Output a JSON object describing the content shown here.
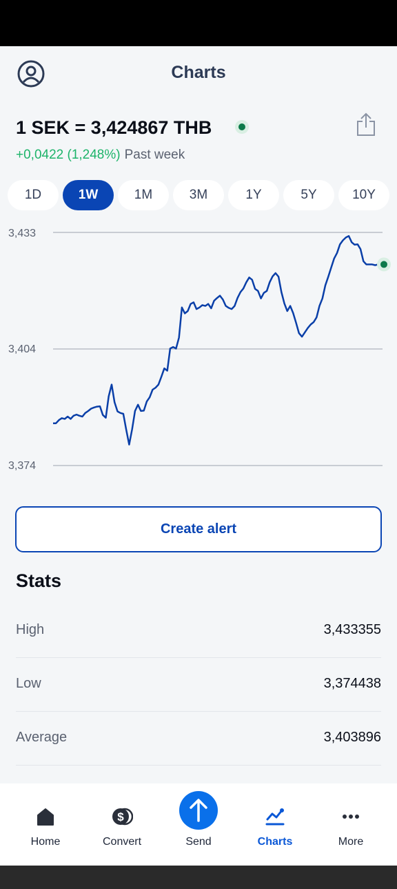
{
  "header": {
    "title": "Charts"
  },
  "rate": {
    "text": "1 SEK = 3,424867 THB",
    "change": "+0,0422 (1,248%)",
    "period": "Past week"
  },
  "ranges": [
    {
      "label": "1D",
      "active": false
    },
    {
      "label": "1W",
      "active": true
    },
    {
      "label": "1M",
      "active": false
    },
    {
      "label": "3M",
      "active": false
    },
    {
      "label": "1Y",
      "active": false
    },
    {
      "label": "5Y",
      "active": false
    },
    {
      "label": "10Y",
      "active": false
    }
  ],
  "chart_data": {
    "type": "line",
    "ylim": [
      3.374,
      3.433
    ],
    "y_ticks": [
      "3,433",
      "3,404",
      "3,374"
    ],
    "grid": true,
    "color": "#0a3fa8",
    "y": [
      3.3847,
      3.3847,
      3.3855,
      3.386,
      3.3858,
      3.3864,
      3.3858,
      3.3866,
      3.3869,
      3.3866,
      3.3864,
      3.3873,
      3.3878,
      3.3884,
      3.3887,
      3.3889,
      3.389,
      3.3868,
      3.3861,
      3.3915,
      3.3945,
      3.39,
      3.3877,
      3.3873,
      3.3871,
      3.383,
      3.3793,
      3.3832,
      3.3878,
      3.3894,
      3.3878,
      3.3879,
      3.3902,
      3.3913,
      3.3932,
      3.3937,
      3.3945,
      3.3965,
      3.3986,
      3.398,
      3.4036,
      3.404,
      3.4036,
      3.4064,
      3.414,
      3.4125,
      3.4131,
      3.4149,
      3.4153,
      3.4136,
      3.414,
      3.4146,
      3.4144,
      3.4149,
      3.4138,
      3.4157,
      3.4164,
      3.417,
      3.416,
      3.4144,
      3.4139,
      3.4136,
      3.4144,
      3.4164,
      3.4179,
      3.4188,
      3.4204,
      3.4216,
      3.421,
      3.4187,
      3.4182,
      3.4163,
      3.4177,
      3.4182,
      3.4204,
      3.4219,
      3.4227,
      3.4218,
      3.4179,
      3.415,
      3.4131,
      3.4144,
      3.4126,
      3.4101,
      3.4075,
      3.4066,
      3.4077,
      3.4088,
      3.4097,
      3.4103,
      3.4115,
      3.4144,
      3.4163,
      3.4196,
      3.4218,
      3.4241,
      3.4264,
      3.4278,
      3.43,
      3.431,
      3.4317,
      3.4321,
      3.4305,
      3.4299,
      3.43,
      3.4288,
      3.4257,
      3.4249,
      3.4249,
      3.4249,
      3.4247,
      3.4249,
      3.4249,
      3.4249
    ],
    "last_marker_color": "#0c7a4a"
  },
  "alert": {
    "label": "Create alert"
  },
  "stats": {
    "title": "Stats",
    "rows": [
      {
        "label": "High",
        "value": "3,433355"
      },
      {
        "label": "Low",
        "value": "3,374438"
      },
      {
        "label": "Average",
        "value": "3,403896"
      }
    ]
  },
  "nav": [
    {
      "label": "Home",
      "icon": "home-icon",
      "active": false
    },
    {
      "label": "Convert",
      "icon": "convert-icon",
      "active": false
    },
    {
      "label": "Send",
      "icon": "send-arrow-icon",
      "active": false
    },
    {
      "label": "Charts",
      "icon": "charts-icon",
      "active": true
    },
    {
      "label": "More",
      "icon": "more-dots-icon",
      "active": false
    }
  ],
  "colors": {
    "brand": "#0a45b4",
    "positive": "#1db46a",
    "nav_active": "#0a57d6"
  }
}
